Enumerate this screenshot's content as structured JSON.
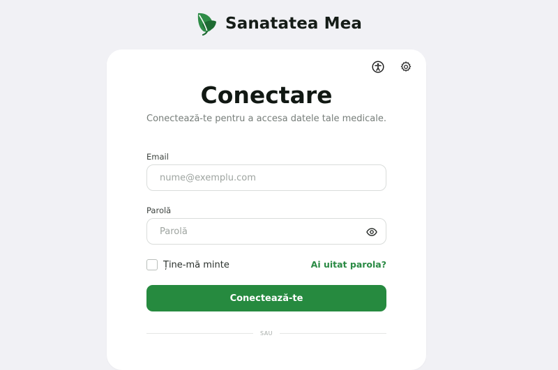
{
  "brand": {
    "name": "Sanatatea Mea",
    "logo_icon": "leaf-icon",
    "accent_color": "#2a8a44"
  },
  "header_icons": [
    {
      "name": "accessibility-icon"
    },
    {
      "name": "settings-gear-icon"
    }
  ],
  "login": {
    "title": "Conectare",
    "subtitle": "Conectează-te pentru a accesa datele tale medicale.",
    "email": {
      "label": "Email",
      "value": "",
      "placeholder": "nume@exemplu.com"
    },
    "password": {
      "label": "Parolă",
      "value": "",
      "placeholder": "Parolă",
      "toggle_icon": "eye-icon"
    },
    "remember_me": {
      "label": "Ține-mă minte",
      "checked": false
    },
    "forgot_password": "Ai uitat parola?",
    "submit_label": "Conectează-te",
    "divider_text": "SAU"
  }
}
